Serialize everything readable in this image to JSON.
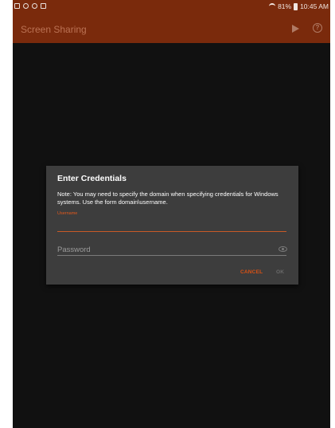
{
  "status_bar": {
    "left_icons": [
      "image-icon",
      "headset-icon",
      "sync-icon",
      "message-icon"
    ],
    "wifi_icon": "wifi-icon",
    "battery_percent": "81%",
    "battery_icon": "battery-icon",
    "time": "10:45 AM"
  },
  "app_bar": {
    "title": "Screen Sharing",
    "actions": [
      "play-icon",
      "help-icon"
    ],
    "color": "#7a2a0c"
  },
  "dialog": {
    "title": "Enter Credentials",
    "note": "Note: You may need to specify the domain when specifying credentials for Windows systems. Use the form domain\\username.",
    "username": {
      "label": "Username",
      "value": ""
    },
    "password": {
      "placeholder": "Password",
      "value": "",
      "toggle_icon": "eye-icon"
    },
    "cancel_label": "CANCEL",
    "ok_label": "OK",
    "accent_color": "#d95114"
  }
}
